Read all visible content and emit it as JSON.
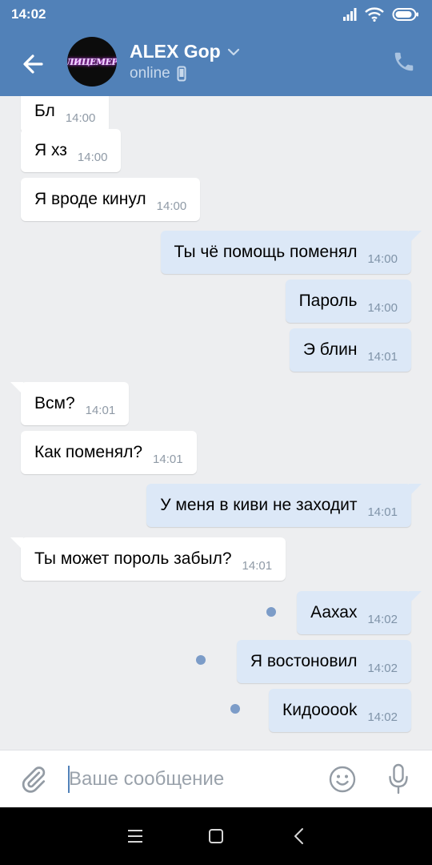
{
  "status_bar": {
    "time": "14:02",
    "icons": [
      "signal-icon",
      "wifi-icon",
      "battery-icon"
    ]
  },
  "header": {
    "back_icon": "arrow-left-icon",
    "avatar_text": "ЛИЦЕМЕР",
    "contact_name": "ALEX Gop",
    "contact_status": "online",
    "status_device_icon": "mobile-phone-icon",
    "call_icon": "phone-icon",
    "colors": {
      "bar": "#5181b8"
    }
  },
  "messages": [
    {
      "direction": "in",
      "text": "Бл",
      "time": "14:00",
      "tail": false,
      "unread": false
    },
    {
      "direction": "in",
      "text": "Я хз",
      "time": "14:00",
      "tail": false,
      "unread": false
    },
    {
      "direction": "in",
      "text": "Я вроде кинул",
      "time": "14:00",
      "tail": false,
      "unread": false
    },
    {
      "direction": "out",
      "text": "Ты чё помощь поменял",
      "time": "14:00",
      "tail": true,
      "unread": false
    },
    {
      "direction": "out",
      "text": "Пароль",
      "time": "14:00",
      "tail": false,
      "unread": false
    },
    {
      "direction": "out",
      "text": "Э блин",
      "time": "14:01",
      "tail": false,
      "unread": false
    },
    {
      "direction": "in",
      "text": "Всм?",
      "time": "14:01",
      "tail": true,
      "unread": false
    },
    {
      "direction": "in",
      "text": "Как поменял?",
      "time": "14:01",
      "tail": false,
      "unread": false
    },
    {
      "direction": "out",
      "text": "У меня в киви не заходит",
      "time": "14:01",
      "tail": true,
      "unread": false
    },
    {
      "direction": "in",
      "text": "Ты может пороль забыл?",
      "time": "14:01",
      "tail": true,
      "unread": false
    },
    {
      "direction": "out",
      "text": "Аахах",
      "time": "14:02",
      "tail": true,
      "unread": true
    },
    {
      "direction": "out",
      "text": "Я востоновил",
      "time": "14:02",
      "tail": false,
      "unread": true
    },
    {
      "direction": "out",
      "text": "Кидооook",
      "time": "14:02",
      "tail": false,
      "unread": true
    }
  ],
  "composer": {
    "attach_icon": "paperclip-icon",
    "placeholder": "Ваше сообщение",
    "value": "",
    "emoji_icon": "smiley-icon",
    "mic_icon": "microphone-icon"
  },
  "nav_bar": {
    "icons": [
      "menu-icon",
      "home-icon",
      "back-icon"
    ]
  },
  "colors": {
    "background": "#edeef0",
    "incoming_bubble": "#ffffff",
    "outgoing_bubble": "#dce8f7",
    "unread_dot": "#7c9cc8"
  }
}
